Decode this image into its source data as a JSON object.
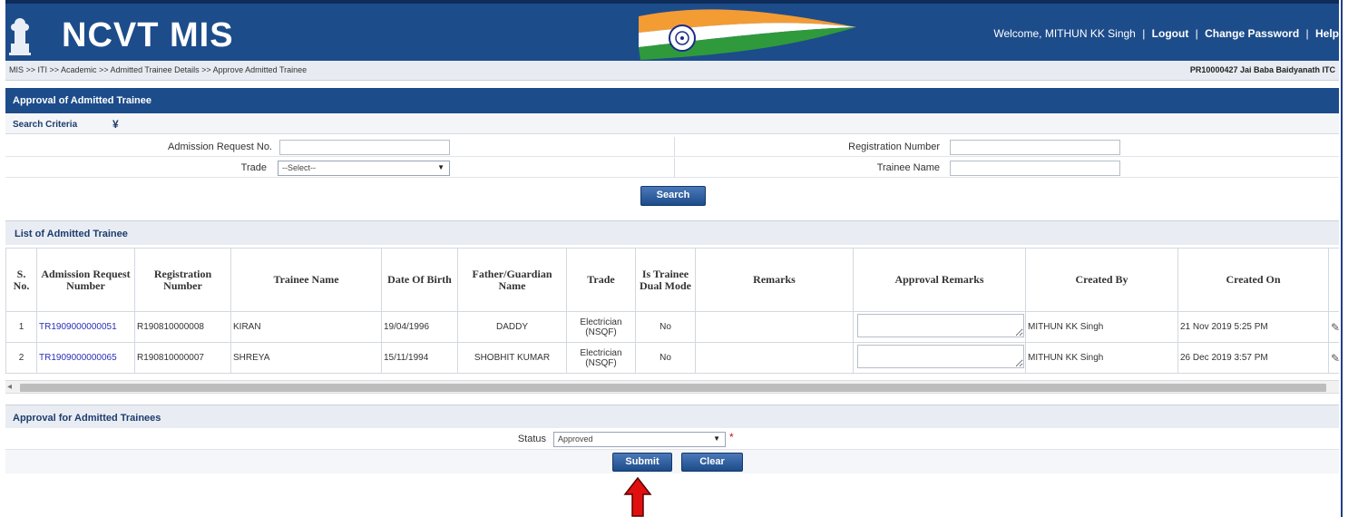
{
  "header": {
    "app_title": "NCVT MIS",
    "welcome": "Welcome, MITHUN KK Singh",
    "logout": "Logout",
    "change_password": "Change Password",
    "help": "Help",
    "separator": "|"
  },
  "breadcrumb": {
    "path": "MIS >> ITI >> Academic >> Admitted Trainee Details >> Approve Admitted Trainee",
    "institute": "PR10000427 Jai Baba Baidyanath ITC"
  },
  "page": {
    "title": "Approval of Admitted Trainee"
  },
  "search_criteria": {
    "label": "Search Criteria",
    "toggle": "¥",
    "admission_request_label": "Admission Request No.",
    "admission_request_value": "",
    "registration_number_label": "Registration Number",
    "registration_number_value": "",
    "trade_label": "Trade",
    "trade_selected": "--Select--",
    "trainee_name_label": "Trainee Name",
    "trainee_name_value": "",
    "search_button": "Search"
  },
  "list": {
    "title": "List of Admitted Trainee",
    "columns": {
      "sno": "S. No.",
      "admission_request_number": "Admission Request Number",
      "registration_number": "Registration Number",
      "trainee_name": "Trainee Name",
      "dob": "Date Of Birth",
      "guardian": "Father/Guardian Name",
      "trade": "Trade",
      "dual_mode": "Is Trainee Dual Mode",
      "remarks": "Remarks",
      "approval_remarks": "Approval Remarks",
      "created_by": "Created By",
      "created_on": "Created On"
    },
    "rows": [
      {
        "sno": "1",
        "admission_request_number": "TR1909000000051",
        "registration_number": "R190810000008",
        "trainee_name": "KIRAN",
        "dob": "19/04/1996",
        "guardian": "DADDY",
        "trade_line1": "Electrician",
        "trade_line2": "(NSQF)",
        "dual_mode": "No",
        "remarks": "",
        "approval_remarks": "",
        "created_by": "MITHUN KK Singh",
        "created_on": "21 Nov 2019 5:25 PM"
      },
      {
        "sno": "2",
        "admission_request_number": "TR1909000000065",
        "registration_number": "R190810000007",
        "trainee_name": "SHREYA",
        "dob": "15/11/1994",
        "guardian": "SHOBHIT KUMAR",
        "trade_line1": "Electrician",
        "trade_line2": "(NSQF)",
        "dual_mode": "No",
        "remarks": "",
        "approval_remarks": "",
        "created_by": "MITHUN KK Singh",
        "created_on": "26 Dec 2019 3:57 PM"
      }
    ]
  },
  "approval": {
    "title": "Approval for Admitted Trainees",
    "status_label": "Status",
    "status_selected": "Approved",
    "required_mark": "*",
    "submit_button": "Submit",
    "clear_button": "Clear"
  },
  "colors": {
    "header_blue": "#1d4c8b",
    "link_blue": "#2a2fb8",
    "annotation_red": "#e01010"
  }
}
